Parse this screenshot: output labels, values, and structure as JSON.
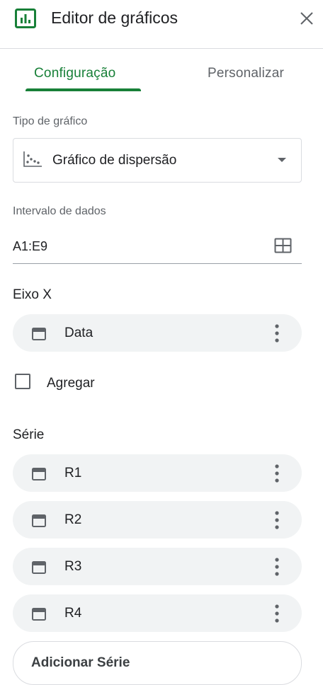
{
  "header": {
    "title": "Editor de gráficos",
    "logo_icon": "chart-logo-icon",
    "close_icon": "close-icon"
  },
  "tabs": [
    {
      "label": "Configuração",
      "active": true
    },
    {
      "label": "Personalizar",
      "active": false
    }
  ],
  "chart_type": {
    "label": "Tipo de gráfico",
    "value": "Gráfico de dispersão",
    "icon": "scatter-chart-icon"
  },
  "data_range": {
    "label": "Intervalo de dados",
    "value": "A1:E9"
  },
  "x_axis": {
    "title": "Eixo X",
    "field": "Data"
  },
  "aggregate": {
    "label": "Agregar",
    "checked": false
  },
  "series": {
    "title": "Série",
    "items": [
      "R1",
      "R2",
      "R3",
      "R4"
    ]
  },
  "add_series_label": "Adicionar Série",
  "colors": {
    "accent_green": "#188038",
    "pill_bg": "#f1f3f4",
    "border": "#dadce0",
    "text": "#202124",
    "muted": "#5f6368"
  }
}
